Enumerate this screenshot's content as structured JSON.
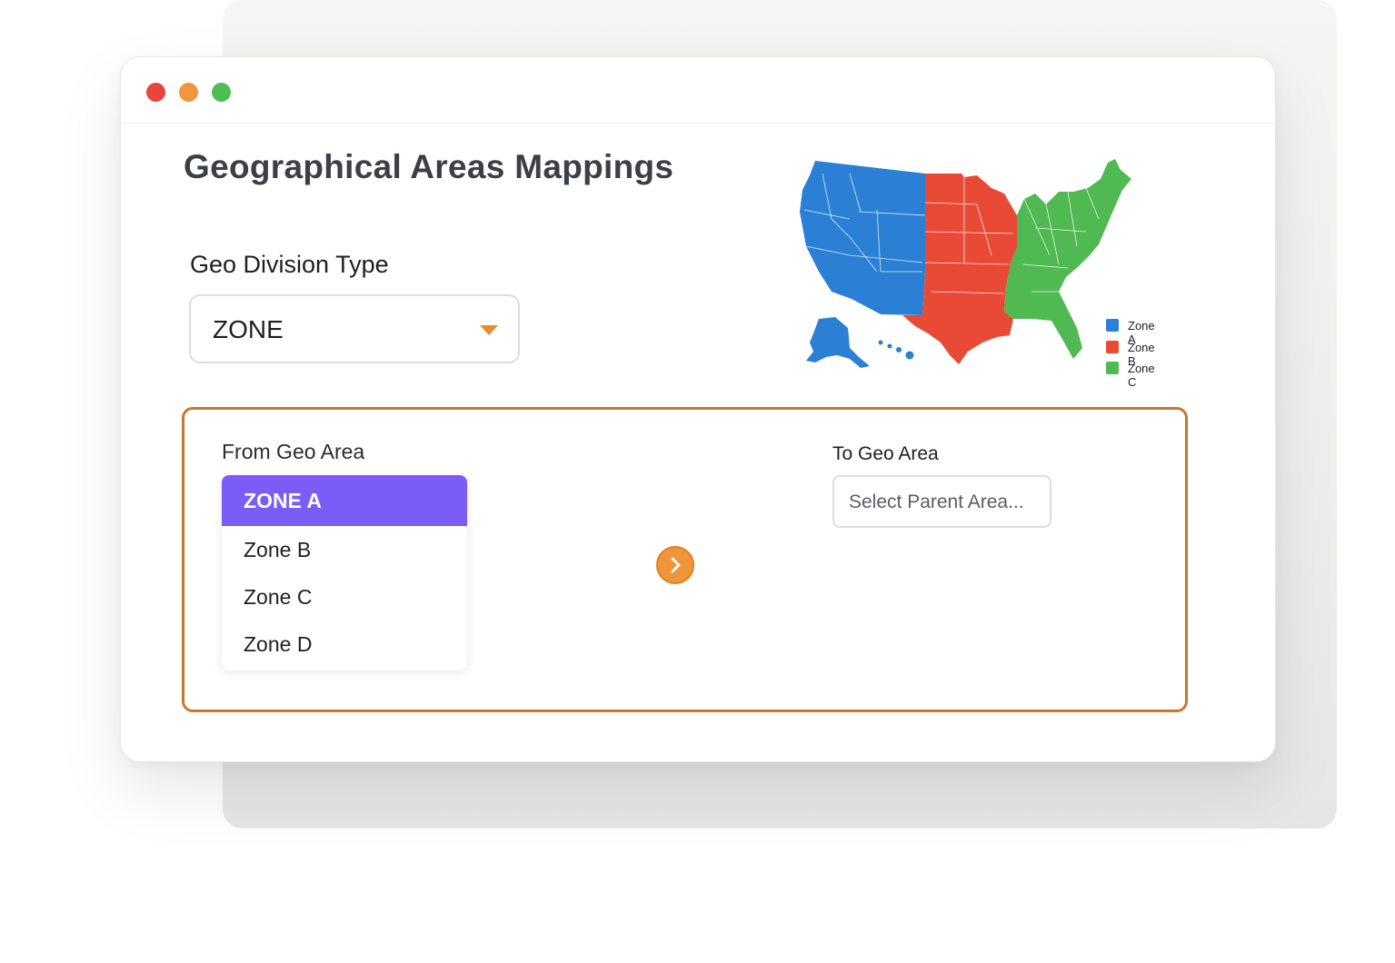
{
  "window": {
    "traffic_lights": [
      {
        "name": "close",
        "color": "#e8463a"
      },
      {
        "name": "minimize",
        "color": "#f1963e"
      },
      {
        "name": "zoom",
        "color": "#4dbf52"
      }
    ]
  },
  "page": {
    "title": "Geographical Areas Mappings"
  },
  "geo_division": {
    "label": "Geo Division Type",
    "selected": "ZONE",
    "icon": "caret-down-icon"
  },
  "map": {
    "legend": [
      {
        "label": "Zone A",
        "color": "#2b7fd4"
      },
      {
        "label": "Zone B",
        "color": "#e84a35"
      },
      {
        "label": "Zone C",
        "color": "#50b952"
      }
    ]
  },
  "mapping": {
    "from_label": "From Geo Area",
    "from_options": [
      {
        "label": "ZONE A",
        "selected": true
      },
      {
        "label": "Zone B",
        "selected": false
      },
      {
        "label": "Zone C",
        "selected": false
      },
      {
        "label": "Zone D",
        "selected": false
      }
    ],
    "arrow_icon": "chevron-right-icon",
    "to_label": "To Geo Area",
    "to_placeholder": "Select Parent Area..."
  },
  "colors": {
    "accent_orange": "#f1953a",
    "panel_border": "#c9782d",
    "selected_purple": "#7b5cf7"
  }
}
